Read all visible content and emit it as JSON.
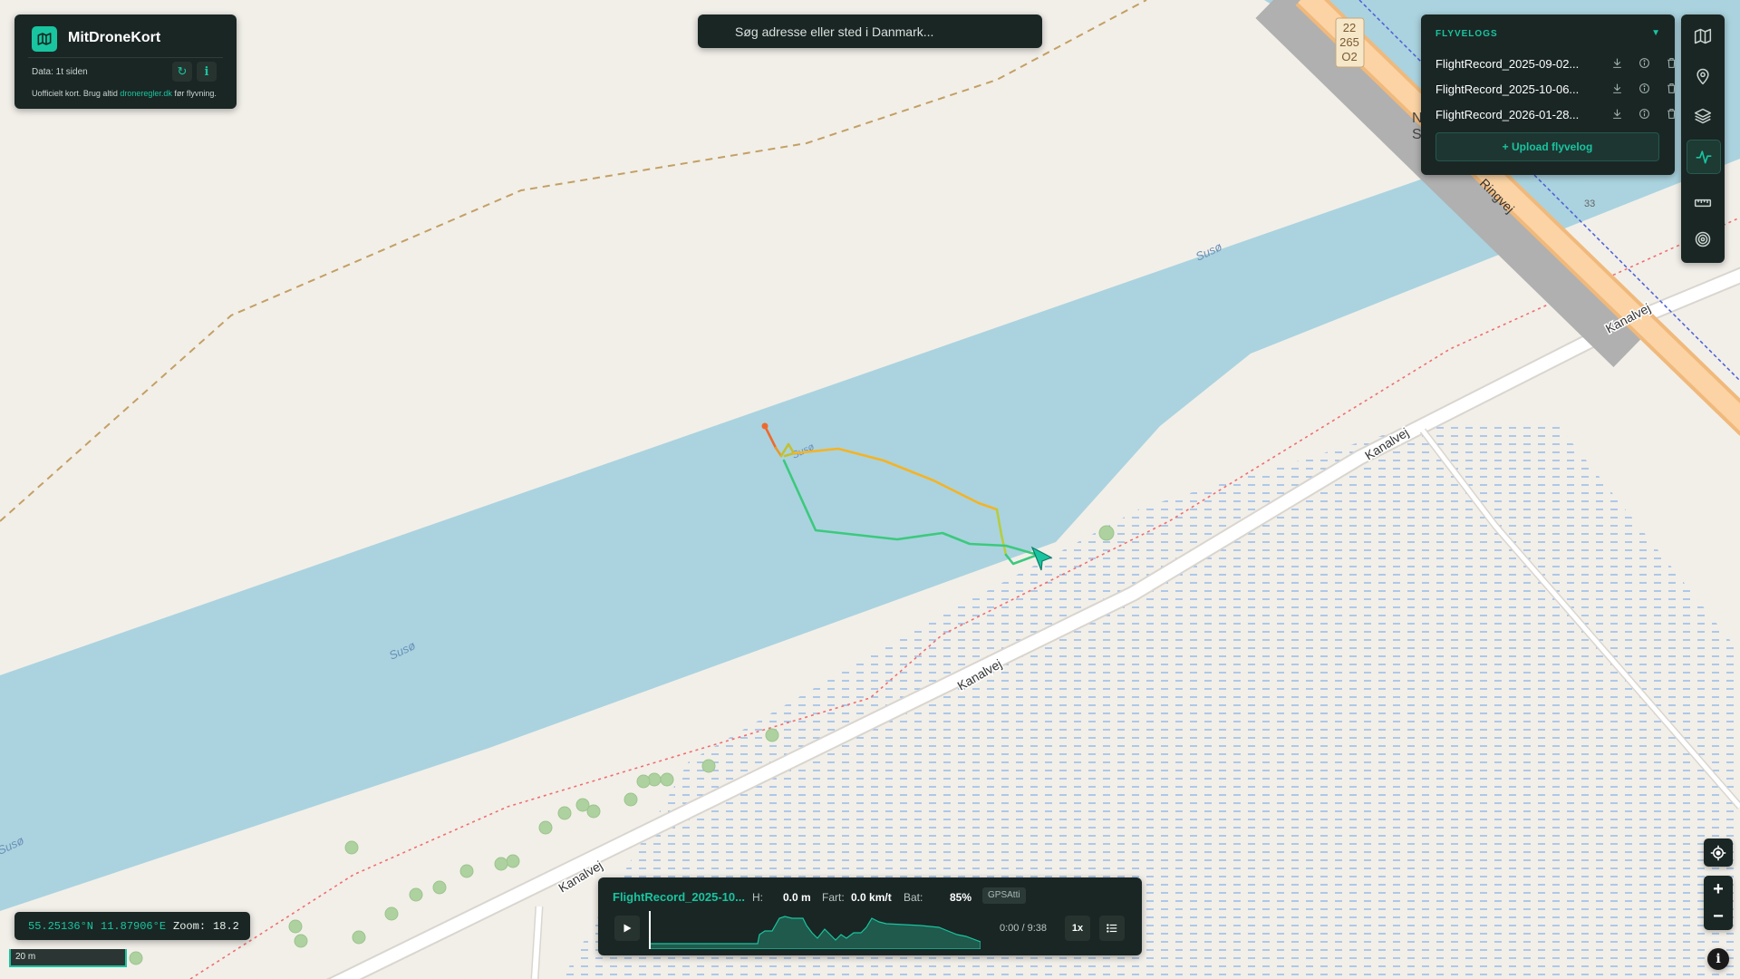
{
  "app": {
    "title": "MitDroneKort"
  },
  "brand": {
    "data_status": "Data: 1t siden",
    "refresh_icon": "refresh-icon",
    "info_icon": "info-icon",
    "note_prefix": "Uofficielt kort. Brug altid ",
    "note_link": "droneregler.dk",
    "note_suffix": " før flyvning."
  },
  "search": {
    "placeholder": "Søg adresse eller sted i Danmark..."
  },
  "flightlogs": {
    "title": "FLYVELOGS",
    "items": [
      {
        "name": "FlightRecord_2025-09-02..."
      },
      {
        "name": "FlightRecord_2025-10-06..."
      },
      {
        "name": "FlightRecord_2026-01-28..."
      }
    ],
    "upload_label": "+ Upload flyvelog"
  },
  "toolbar": [
    "map-icon",
    "pin-icon",
    "layers-icon",
    "activity-icon",
    "ruler-icon",
    "target-icon"
  ],
  "map_labels": {
    "water": "Susø",
    "road": "Kanalvej",
    "ringroad": "Ringvej",
    "ring_route_number": "33",
    "shield_line1": "22",
    "shield_line2": "265",
    "shield_line3": "O2",
    "partial_name_1": "N",
    "partial_name_2": "S",
    "track_label": "Susø"
  },
  "status": {
    "lat": "55.25136°N",
    "lon": "11.87906°E",
    "zoom_label": "Zoom:",
    "zoom": "18.2",
    "scale": "20 m"
  },
  "player": {
    "name": "FlightRecord_2025-10...",
    "height_label": "H:",
    "height": "0.0 m",
    "speed_label": "Fart:",
    "speed": "0.0 km/t",
    "battery_label": "Bat:",
    "battery": "85%",
    "mode": "GPSAtti",
    "time": "0:00 / 9:38",
    "playback_speed": "1x",
    "duration_seconds": 578,
    "position_seconds": 0
  },
  "colors": {
    "panel": "#1a2624",
    "accent": "#19c4a0",
    "water": "#aad3df",
    "land": "#f2efe9",
    "track_start": "#ee6a2c",
    "track_mid": "#f5b324",
    "track_end": "#3cc97d"
  }
}
